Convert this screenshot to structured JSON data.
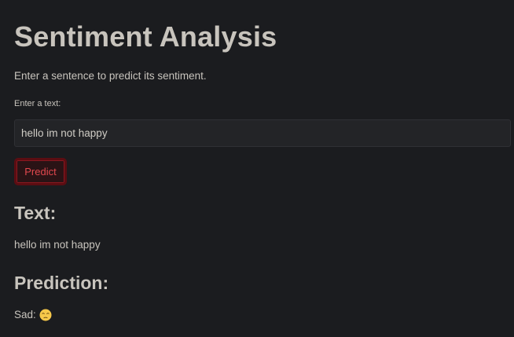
{
  "app": {
    "title": "Sentiment Analysis",
    "subtitle": "Enter a sentence to predict its sentiment."
  },
  "form": {
    "input_label": "Enter a text:",
    "input_value": "hello im not happy",
    "button_label": "Predict"
  },
  "results": {
    "text_heading": "Text:",
    "text_value": "hello im not happy",
    "prediction_heading": "Prediction:",
    "prediction_label": "Sad:",
    "prediction_icon": "pensive-face-icon"
  },
  "colors": {
    "background": "#1b1c1f",
    "text": "#c8c4bd",
    "accent": "#e2484e",
    "button_border": "#5b0d12",
    "input_background": "#232427"
  }
}
